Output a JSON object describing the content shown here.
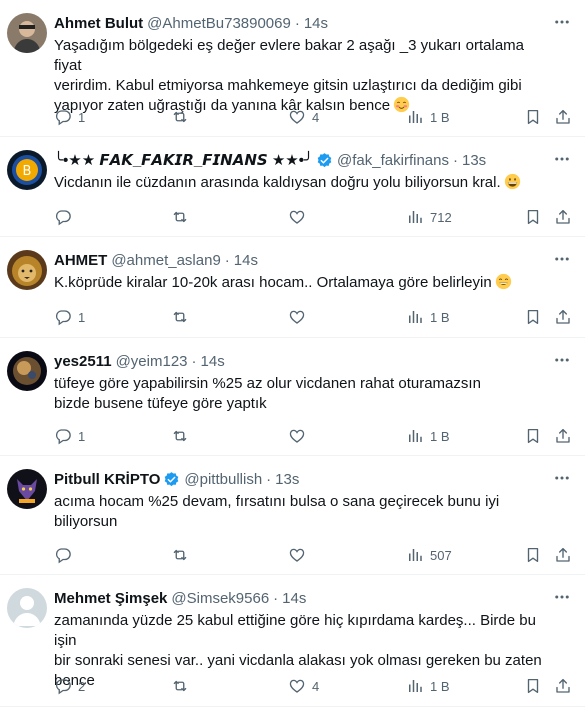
{
  "tweets": [
    {
      "name": "Ahmet Bulut",
      "handle": "@AhmetBu73890069",
      "time": "14s",
      "verified": false,
      "text_lines": [
        "Yaşadığım bölgedeki eş değer evlere bakar 2 aşağı _3 yukarı ortalama fiyat",
        "verirdim. Kabul etmiyorsa mahkemeye gitsin uzlaştırıcı da dediğim gibi",
        "yapıyor zaten uğraştığı da yanına kâr kalsın bence"
      ],
      "emoji": "blush",
      "replies": "1",
      "retweets": "",
      "likes": "4",
      "views": "1 B"
    },
    {
      "name": "╰•★★ 𝙁𝘼𝙆_𝙁𝘼𝙆𝙄𝙍_𝙁𝙄𝙉𝘼𝙉𝙎 ★★•╯",
      "handle": "@fak_fakirfinans",
      "time": "13s",
      "verified": true,
      "text_lines": [
        "Vicdanın ile cüzdanın arasında kaldıysan doğru yolu biliyorsun kral."
      ],
      "emoji": "grin",
      "replies": "",
      "retweets": "",
      "likes": "",
      "views": "712"
    },
    {
      "name": "AHMET",
      "handle": "@ahmet_aslan9",
      "time": "14s",
      "verified": false,
      "text_lines": [
        "K.köprüde kiralar 10-20k arası hocam.. Ortalamaya göre belirleyin"
      ],
      "emoji": "smile",
      "replies": "1",
      "retweets": "",
      "likes": "",
      "views": "1 B"
    },
    {
      "name": "yes2511",
      "handle": "@yeim123",
      "time": "14s",
      "verified": false,
      "text_lines": [
        "tüfeye göre yapabilirsin %25 az olur vicdanen rahat oturamazsın",
        "bizde busene tüfeye göre yaptık"
      ],
      "emoji": "",
      "replies": "1",
      "retweets": "",
      "likes": "",
      "views": "1 B"
    },
    {
      "name": "Pitbull KRİPTO",
      "handle": "@pittbullish",
      "time": "13s",
      "verified": true,
      "text_lines": [
        "acıma hocam %25 devam, fırsatını bulsa o sana geçirecek bunu iyi",
        "biliyorsun"
      ],
      "emoji": "",
      "replies": "",
      "retweets": "",
      "likes": "",
      "views": "507"
    },
    {
      "name": "Mehmet Şimşek",
      "handle": "@Simsek9566",
      "time": "14s",
      "verified": false,
      "text_lines": [
        "zamanında yüzde 25 kabul ettiğine göre hiç kıpırdama kardeş... Birde bu işin",
        "bir sonraki senesi var.. yani vicdanla alakası yok olması gereken bu zaten",
        "bence"
      ],
      "emoji": "",
      "replies": "2",
      "retweets": "",
      "likes": "4",
      "views": "1 B"
    }
  ],
  "icons": {
    "reply": "reply-icon",
    "retweet": "retweet-icon",
    "like": "like-icon",
    "views": "views-icon",
    "bookmark": "bookmark-icon",
    "share": "share-icon",
    "more": "more-icon",
    "verified": "verified-badge-icon"
  },
  "colors": {
    "text": "#0f1419",
    "secondary": "#536471",
    "verified": "#1d9bf0",
    "border": "#eff3f4"
  }
}
